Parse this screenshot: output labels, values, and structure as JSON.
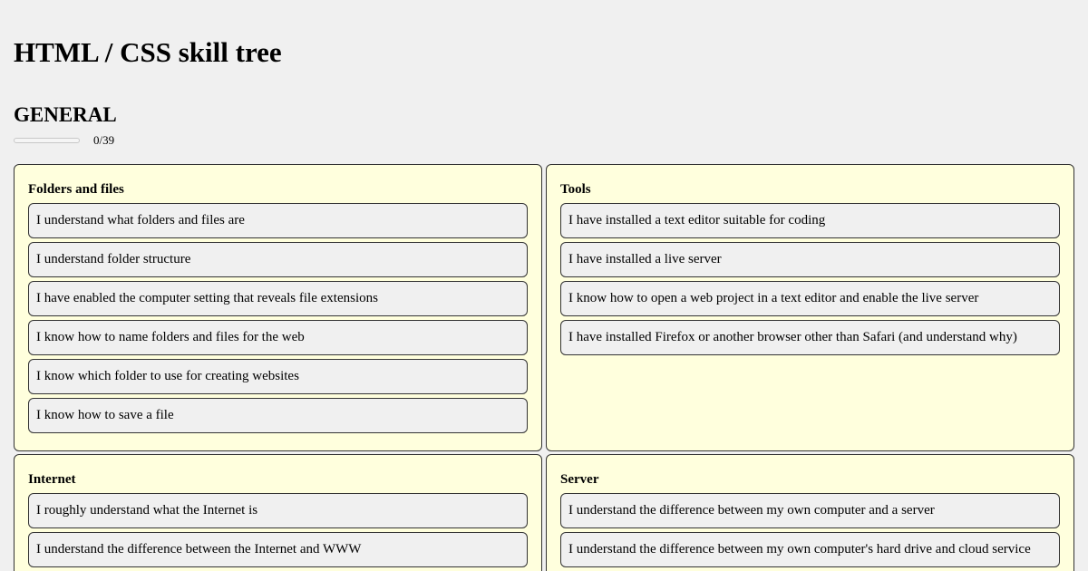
{
  "page": {
    "title": "HTML / CSS skill tree"
  },
  "section": {
    "title": "GENERAL",
    "progress_fraction": 0,
    "progress_text": "0/39"
  },
  "cards": [
    {
      "title": "Folders and files",
      "skills": [
        "I understand what folders and files are",
        "I understand folder structure",
        "I have enabled the computer setting that reveals file extensions",
        "I know how to name folders and files for the web",
        "I know which folder to use for creating websites",
        "I know how to save a file"
      ]
    },
    {
      "title": "Tools",
      "skills": [
        "I have installed a text editor suitable for coding",
        "I have installed a live server",
        "I know how to open a web project in a text editor and enable the live server",
        "I have installed Firefox or another browser other than Safari (and understand why)"
      ]
    },
    {
      "title": "Internet",
      "skills": [
        "I roughly understand what the Internet is",
        "I understand the difference between the Internet and WWW"
      ]
    },
    {
      "title": "Server",
      "skills": [
        "I understand the difference between my own computer and a server",
        "I understand the difference between my own computer's hard drive and cloud service"
      ]
    }
  ]
}
